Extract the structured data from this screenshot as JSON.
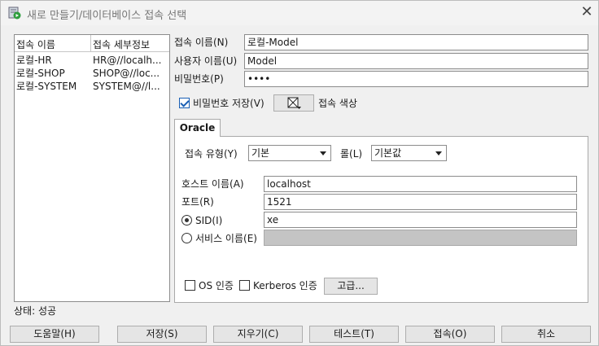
{
  "window": {
    "title": "새로 만들기/데이터베이스 접속 선택",
    "close_glyph": "✕"
  },
  "connections": {
    "headers": [
      "접속 이름",
      "접속 세부정보"
    ],
    "rows": [
      [
        "로컬-HR",
        "HR@//localh..."
      ],
      [
        "로컬-SHOP",
        "SHOP@//loc..."
      ],
      [
        "로컬-SYSTEM",
        "SYSTEM@//l..."
      ]
    ]
  },
  "form": {
    "conn_name_label": "접속 이름(N)",
    "conn_name_value": "로컬-Model",
    "user_label": "사용자 이름(U)",
    "user_value": "Model",
    "password_label": "비밀번호(P)",
    "password_value": "••••",
    "save_password_label": "비밀번호 저장(V)",
    "save_password_checked": true,
    "color_label": "접속 색상"
  },
  "tab": {
    "name": "Oracle",
    "conn_type_label": "접속 유형(Y)",
    "conn_type_value": "기본",
    "role_label": "롤(L)",
    "role_value": "기본값",
    "host_label": "호스트 이름(A)",
    "host_value": "localhost",
    "port_label": "포트(R)",
    "port_value": "1521",
    "sid_label": "SID(I)",
    "sid_value": "xe",
    "service_label": "서비스 이름(E)",
    "service_value": "",
    "os_auth_label": "OS 인증",
    "kerberos_label": "Kerberos 인증",
    "advanced_label": "고급..."
  },
  "status": "상태: 성공",
  "buttons": {
    "help": "도움말(H)",
    "save": "저장(S)",
    "clear": "지우기(C)",
    "test": "테스트(T)",
    "connect": "접속(O)",
    "cancel": "취소"
  },
  "icons": {
    "app": "db-connection-icon",
    "color": "color-picker-icon"
  }
}
